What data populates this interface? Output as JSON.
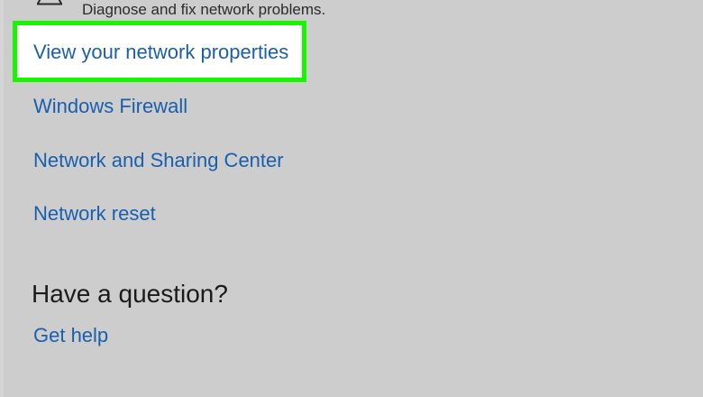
{
  "troubleshooter": {
    "icon": "warning-triangle-icon",
    "description": "Diagnose and fix network problems."
  },
  "links": {
    "network_properties": "View your network properties",
    "windows_firewall": "Windows Firewall",
    "sharing_center": "Network and Sharing Center",
    "network_reset": "Network reset"
  },
  "help_section": {
    "heading": "Have a question?",
    "get_help": "Get help"
  },
  "colors": {
    "background": "#cdcdcd",
    "link": "#1a5fae",
    "highlight_border": "#19f500",
    "highlight_fill": "#ffffff"
  }
}
